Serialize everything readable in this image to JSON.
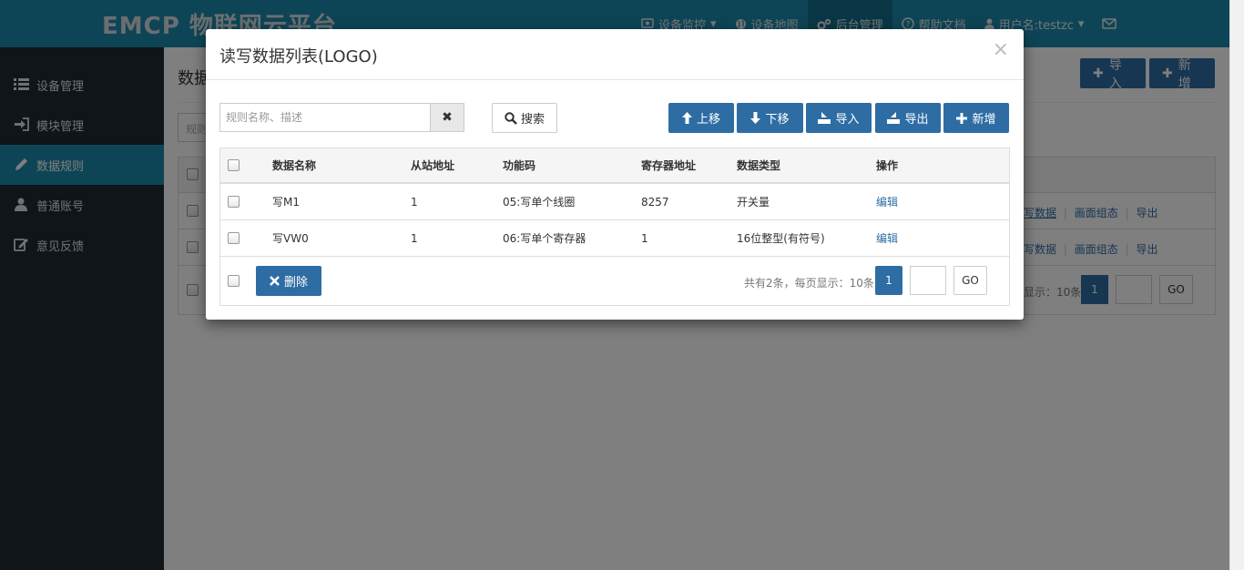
{
  "app": {
    "logo_text": "EMCP 物联网云平台",
    "nav": [
      {
        "label": "设备监控",
        "icon": "monitor-icon"
      },
      {
        "label": "设备地图",
        "icon": "globe-icon"
      },
      {
        "label": "后台管理",
        "icon": "gears-icon"
      },
      {
        "label": "帮助文档",
        "icon": "question-icon"
      },
      {
        "label": "用户名:testzc",
        "icon": "user-icon"
      }
    ]
  },
  "sidebar": {
    "items": [
      {
        "label": "设备管理",
        "icon": "list-icon"
      },
      {
        "label": "模块管理",
        "icon": "sign-in-icon"
      },
      {
        "label": "数据规则",
        "icon": "pencil-icon"
      },
      {
        "label": "普通账号",
        "icon": "user-icon"
      },
      {
        "label": "意见反馈",
        "icon": "edit-icon"
      }
    ]
  },
  "background": {
    "page_title": "数据",
    "import_label": "导入",
    "add_label": "新增",
    "filter_placeholder": "规则",
    "row_actions": [
      "写数据",
      "画面组态",
      "导出"
    ],
    "pagination_info": "显示：10条",
    "page": "1",
    "go": "GO"
  },
  "modal": {
    "title": "读写数据列表(LOGO)",
    "close": "×",
    "search_placeholder": "规则名称、描述",
    "search_value": "",
    "search_label": "搜索",
    "toolbar": {
      "up": "上移",
      "down": "下移",
      "import": "导入",
      "export": "导出",
      "add": "新增"
    },
    "table": {
      "headers": [
        "数据名称",
        "从站地址",
        "功能码",
        "寄存器地址",
        "数据类型",
        "操作"
      ],
      "rows": [
        {
          "name": "写M1",
          "station": "1",
          "func": "05:写单个线圈",
          "register": "8257",
          "type": "开关量",
          "action": "编辑"
        },
        {
          "name": "写VW0",
          "station": "1",
          "func": "06:写单个寄存器",
          "register": "1",
          "type": "16位整型(有符号)",
          "action": "编辑"
        }
      ]
    },
    "delete_label": "删除",
    "pagination_info": "共有2条，每页显示：10条",
    "page": "1",
    "go": "GO"
  },
  "colors": {
    "primary": "#2e6da4",
    "topbar": "#1d8bac",
    "sidebar": "#1f2a33"
  }
}
